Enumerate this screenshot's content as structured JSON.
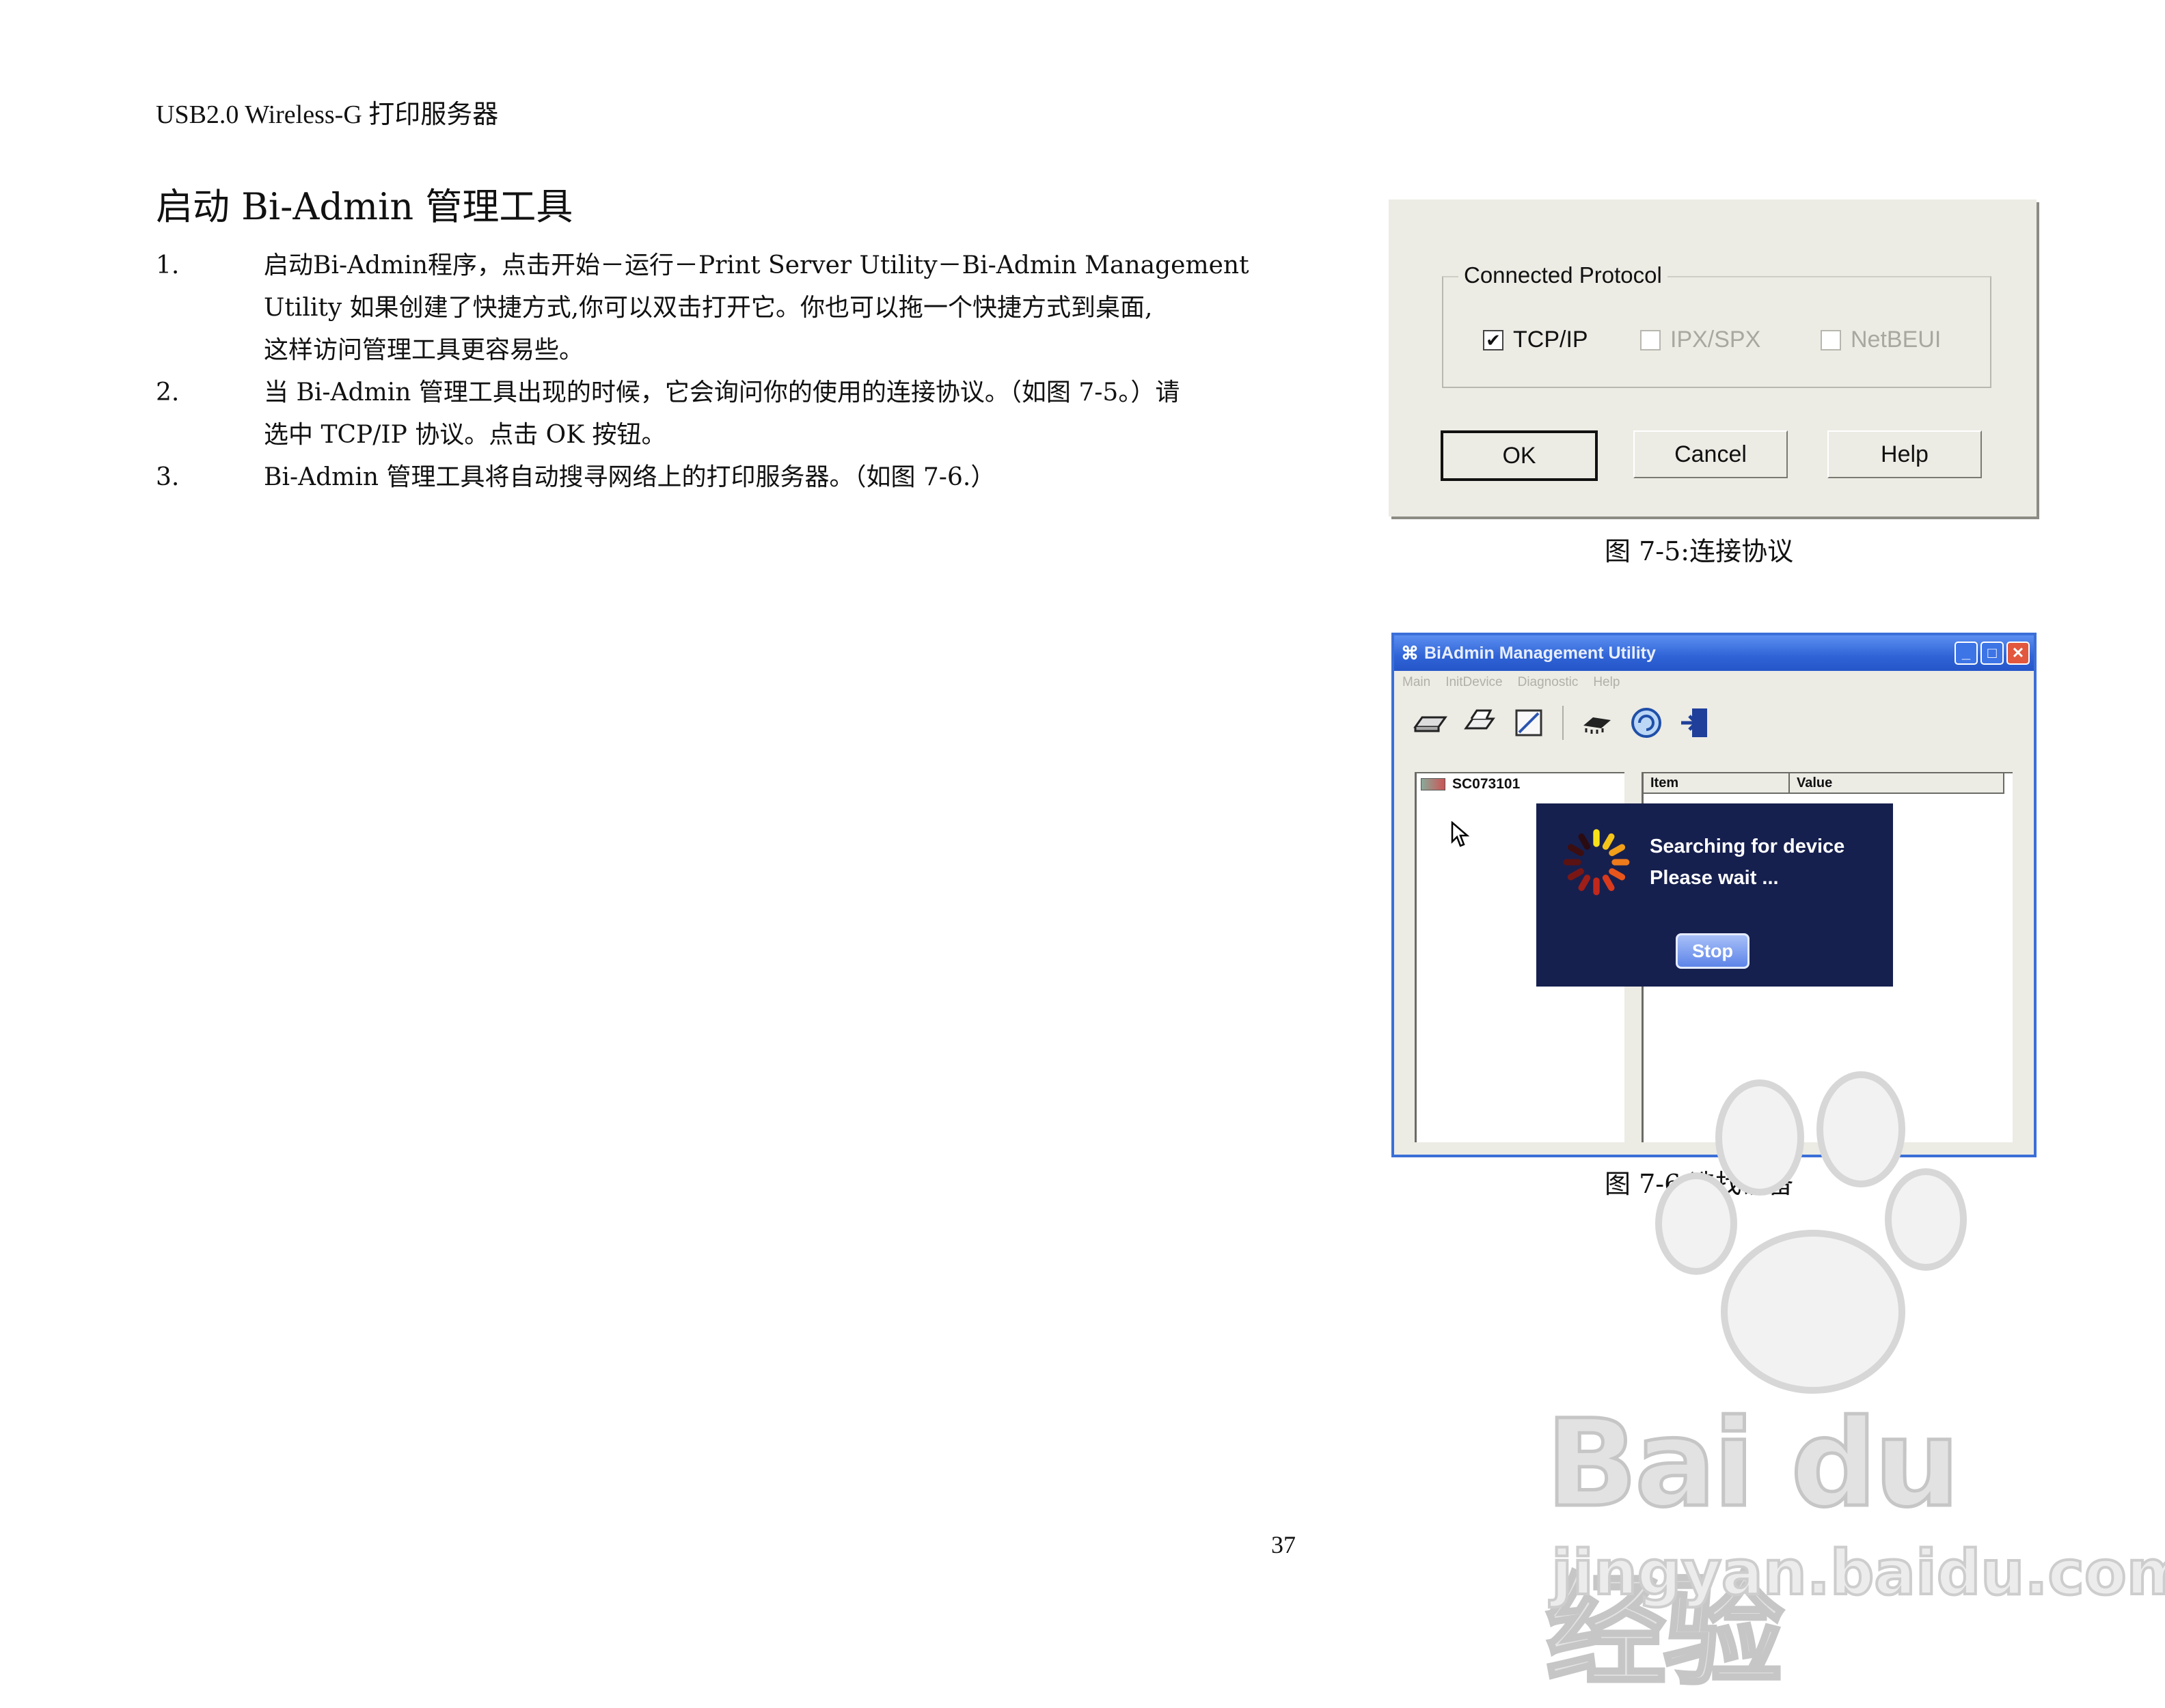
{
  "page": {
    "header": "USB2.0 Wireless-G 打印服务器",
    "title": "启动 Bi-Admin 管理工具",
    "steps": [
      {
        "num": "1.",
        "line1": "启动Bi-Admin程序，点击开始－运行－Print Server Utility－Bi-Admin Management",
        "line2": "Utility 如果创建了快捷方式,你可以双击打开它。你也可以拖一个快捷方式到桌面,",
        "line3": "这样访问管理工具更容易些。"
      },
      {
        "num": "2.",
        "line1": "当 Bi-Admin 管理工具出现的时候，它会询问你的使用的连接协议。（如图 7-5。）请",
        "line2": "选中 TCP/IP 协议。点击 OK 按钮。"
      },
      {
        "num": "3.",
        "line1": "Bi-Admin 管理工具将自动搜寻网络上的打印服务器。（如图 7-6.）"
      }
    ],
    "page_number": "37"
  },
  "fig75": {
    "group_label": "Connected Protocol",
    "options": [
      {
        "label": "TCP/IP",
        "checked": true,
        "enabled": true
      },
      {
        "label": "IPX/SPX",
        "checked": false,
        "enabled": false
      },
      {
        "label": "NetBEUI",
        "checked": false,
        "enabled": false
      }
    ],
    "buttons": {
      "ok": "OK",
      "cancel": "Cancel",
      "help": "Help"
    },
    "caption": "图 7-5:连接协议"
  },
  "fig76": {
    "window_title": "BiAdmin Management Utility",
    "menu": [
      "Main",
      "InitDevice",
      "Diagnostic",
      "Help"
    ],
    "tree_item": "SC073101",
    "columns": [
      "Item",
      "Value"
    ],
    "search_line1": "Searching for device",
    "search_line2": "Please wait ...",
    "stop_label": "Stop",
    "caption": "图 7-6:选找设备"
  },
  "watermark": {
    "main": "Bai du 经验",
    "sub": "jingyan.baidu.com"
  }
}
